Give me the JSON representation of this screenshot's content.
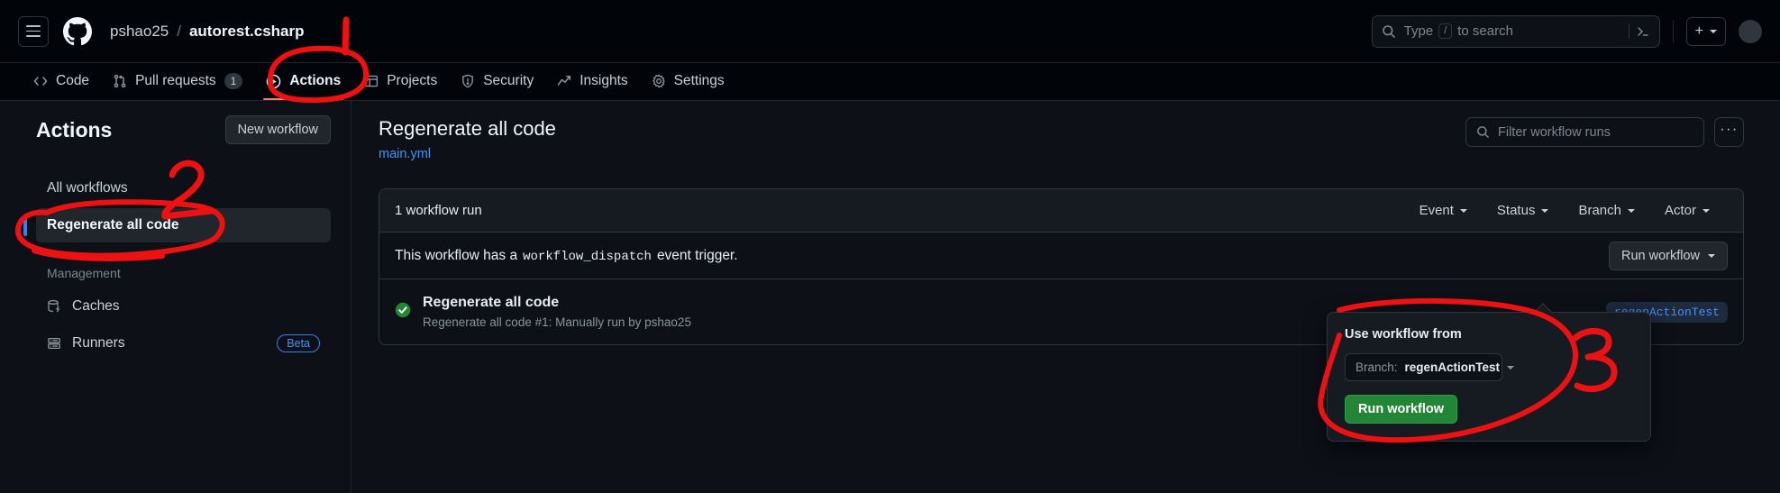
{
  "header": {
    "menu_icon": "hamburger-icon",
    "logo_icon": "github-logo-icon",
    "owner": "pshao25",
    "separator": "/",
    "repo": "autorest.csharp",
    "search_placeholder": "Type",
    "search_key": "/",
    "search_suffix": "to search",
    "terminal_icon": "terminal-icon",
    "plus_label": "+",
    "avatar": "user-avatar"
  },
  "repo_nav": [
    {
      "label": "Code",
      "icon": "code-icon",
      "active": false,
      "count": null
    },
    {
      "label": "Pull requests",
      "icon": "git-pull-request-icon",
      "active": false,
      "count": "1"
    },
    {
      "label": "Actions",
      "icon": "play-circle-icon",
      "active": true,
      "count": null
    },
    {
      "label": "Projects",
      "icon": "table-icon",
      "active": false,
      "count": null
    },
    {
      "label": "Security",
      "icon": "shield-icon",
      "active": false,
      "count": null
    },
    {
      "label": "Insights",
      "icon": "graph-icon",
      "active": false,
      "count": null
    },
    {
      "label": "Settings",
      "icon": "gear-icon",
      "active": false,
      "count": null
    }
  ],
  "sidebar": {
    "title": "Actions",
    "new_workflow_label": "New workflow",
    "all_workflows_label": "All workflows",
    "selected_workflow_label": "Regenerate all code",
    "management_label": "Management",
    "caches_label": "Caches",
    "runners_label": "Runners",
    "runners_badge": "Beta"
  },
  "main": {
    "workflow_title": "Regenerate all code",
    "workflow_file": "main.yml",
    "filter_placeholder": "Filter workflow runs",
    "overflow_label": "···",
    "runs_count": "1 workflow run",
    "filters": [
      {
        "label": "Event"
      },
      {
        "label": "Status"
      },
      {
        "label": "Branch"
      },
      {
        "label": "Actor"
      }
    ],
    "dispatch_prefix": "This workflow has a",
    "dispatch_code": "workflow_dispatch",
    "dispatch_suffix": "event trigger.",
    "run_workflow_label": "Run workflow",
    "run": {
      "status_icon": "check-circle-success-icon",
      "name": "Regenerate all code",
      "subtitle": "Regenerate all code #1: Manually run by pshao25",
      "branch": "regenActionTest"
    }
  },
  "dropdown": {
    "title": "Use workflow from",
    "branch_label": "Branch:",
    "branch_value": "regenActionTest",
    "run_button_label": "Run workflow"
  },
  "annotations": {
    "mark_1": "1",
    "mark_2": "2",
    "mark_3": "3",
    "color": "#ee1111"
  },
  "colors": {
    "accent_blue": "#4493f8",
    "success_green": "#238636",
    "annotation_red": "#ee1111",
    "page_bg": "#0d1117",
    "header_bg": "#010409"
  }
}
